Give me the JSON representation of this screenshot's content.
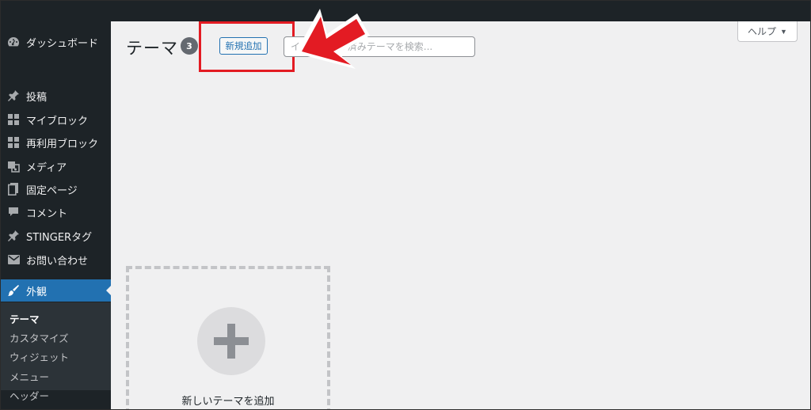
{
  "sidebar": {
    "items": [
      {
        "label": "ダッシュボード",
        "icon": "dashboard-icon"
      },
      {
        "label": "投稿",
        "icon": "pin-icon"
      },
      {
        "label": "マイブロック",
        "icon": "block-grid-icon"
      },
      {
        "label": "再利用ブロック",
        "icon": "block-grid-icon"
      },
      {
        "label": "メディア",
        "icon": "media-icon"
      },
      {
        "label": "固定ページ",
        "icon": "page-icon"
      },
      {
        "label": "コメント",
        "icon": "comment-icon"
      },
      {
        "label": "STINGERタグ",
        "icon": "pin-icon"
      },
      {
        "label": "お問い合わせ",
        "icon": "mail-icon"
      },
      {
        "label": "外観",
        "icon": "appearance-brush-icon",
        "active": true
      }
    ],
    "submenu": [
      {
        "label": "テーマ",
        "current": true
      },
      {
        "label": "カスタマイズ"
      },
      {
        "label": "ウィジェット"
      },
      {
        "label": "メニュー"
      },
      {
        "label": "ヘッダー"
      }
    ]
  },
  "header": {
    "title": "テーマ",
    "theme_count": "3",
    "add_new_label": "新規追加",
    "search_placeholder": "インストール済みテーマを検索...",
    "help_label": "ヘルプ"
  },
  "add_theme_card": {
    "label": "新しいテーマを追加"
  },
  "colors": {
    "sidebar_bg": "#1d2327",
    "active_item": "#2271b1",
    "highlight_red": "#e31b23"
  }
}
